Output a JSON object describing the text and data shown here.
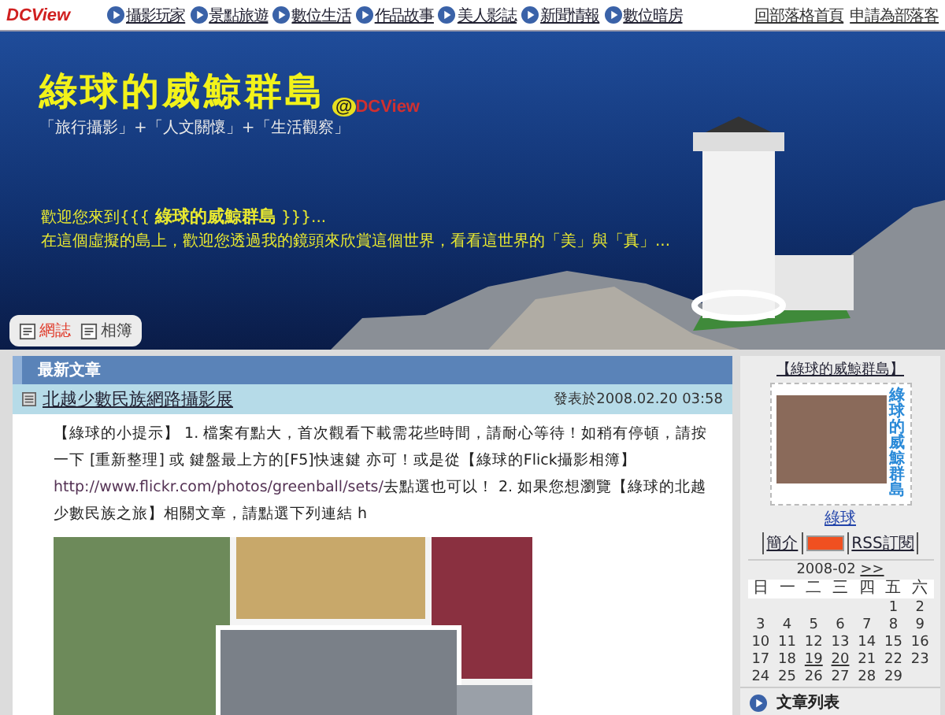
{
  "top_bar": {
    "logo": "DCView",
    "nav": [
      "攝影玩家",
      "景點旅遊",
      "數位生活",
      "作品故事",
      "美人影誌",
      "新聞情報",
      "數位暗房"
    ],
    "links": [
      "回部落格首頁",
      "申請為部落客"
    ]
  },
  "banner": {
    "title": "綠球的威鯨群島",
    "logo_at": "@",
    "logo": "DCView",
    "subtitle": "「旅行攝影」+「人文關懷」+「生活觀察」",
    "welcome_prefix": "歡迎您來到{{{",
    "welcome_name": "綠球的威鯨群島",
    "welcome_suffix": "}}}...",
    "welcome_line2": "在這個虛擬的島上，歡迎您透過我的鏡頭來欣賞這個世界，看看這世界的「美」與「真」...",
    "tabs": [
      {
        "label": "網誌",
        "selected": true
      },
      {
        "label": "相簿",
        "selected": false
      }
    ]
  },
  "section": {
    "title": "最新文章"
  },
  "post": {
    "title": "北越少數民族網路攝影展",
    "date": "發表於2008.02.20 03:58",
    "body_before": "【綠球的小提示】 1. 檔案有點大，首次觀看下載需花些時間，請耐心等待！如稍有停頓，請按一下 [重新整理] 或 鍵盤最上方的[F5]快速鍵 亦可！或是從【綠球的Flick攝影相簿】 ",
    "body_link": "http://www.flickr.com/photos/greenball/sets/",
    "body_after": "去點選也可以！ 2. 如果您想瀏覽【綠球的北越少數民族之旅】相關文章，請點選下列連結 h"
  },
  "sidebar": {
    "blog_link": "【綠球的威鯨群島】",
    "stamp_text": "綠球的威鯨群島",
    "owner": "綠球",
    "intro": "簡介",
    "rss": "RSS訂閱",
    "calendar": {
      "month": "2008-02",
      "next": ">>",
      "weekdays": [
        "日",
        "一",
        "二",
        "三",
        "四",
        "五",
        "六"
      ],
      "weeks": [
        [
          {
            "day": "1",
            "linked": false
          },
          {
            "day": "2",
            "linked": false
          }
        ],
        [
          {
            "day": "3",
            "linked": false
          },
          {
            "day": "4",
            "linked": false
          },
          {
            "day": "5",
            "linked": false
          },
          {
            "day": "6",
            "linked": false
          },
          {
            "day": "7",
            "linked": false
          },
          {
            "day": "8",
            "linked": false
          },
          {
            "day": "9",
            "linked": false
          }
        ],
        [
          {
            "day": "10",
            "linked": false
          },
          {
            "day": "11",
            "linked": false
          },
          {
            "day": "12",
            "linked": false
          },
          {
            "day": "13",
            "linked": false
          },
          {
            "day": "14",
            "linked": false
          },
          {
            "day": "15",
            "linked": false
          },
          {
            "day": "16",
            "linked": false
          }
        ],
        [
          {
            "day": "17",
            "linked": false
          },
          {
            "day": "18",
            "linked": false
          },
          {
            "day": "19",
            "linked": true
          },
          {
            "day": "20",
            "linked": true
          },
          {
            "day": "21",
            "linked": false
          },
          {
            "day": "22",
            "linked": false
          },
          {
            "day": "23",
            "linked": false
          }
        ],
        [
          {
            "day": "24",
            "linked": false
          },
          {
            "day": "25",
            "linked": false
          },
          {
            "day": "26",
            "linked": false
          },
          {
            "day": "27",
            "linked": false
          },
          {
            "day": "28",
            "linked": false
          },
          {
            "day": "29",
            "linked": false
          }
        ]
      ]
    },
    "list_title": "文章列表"
  }
}
